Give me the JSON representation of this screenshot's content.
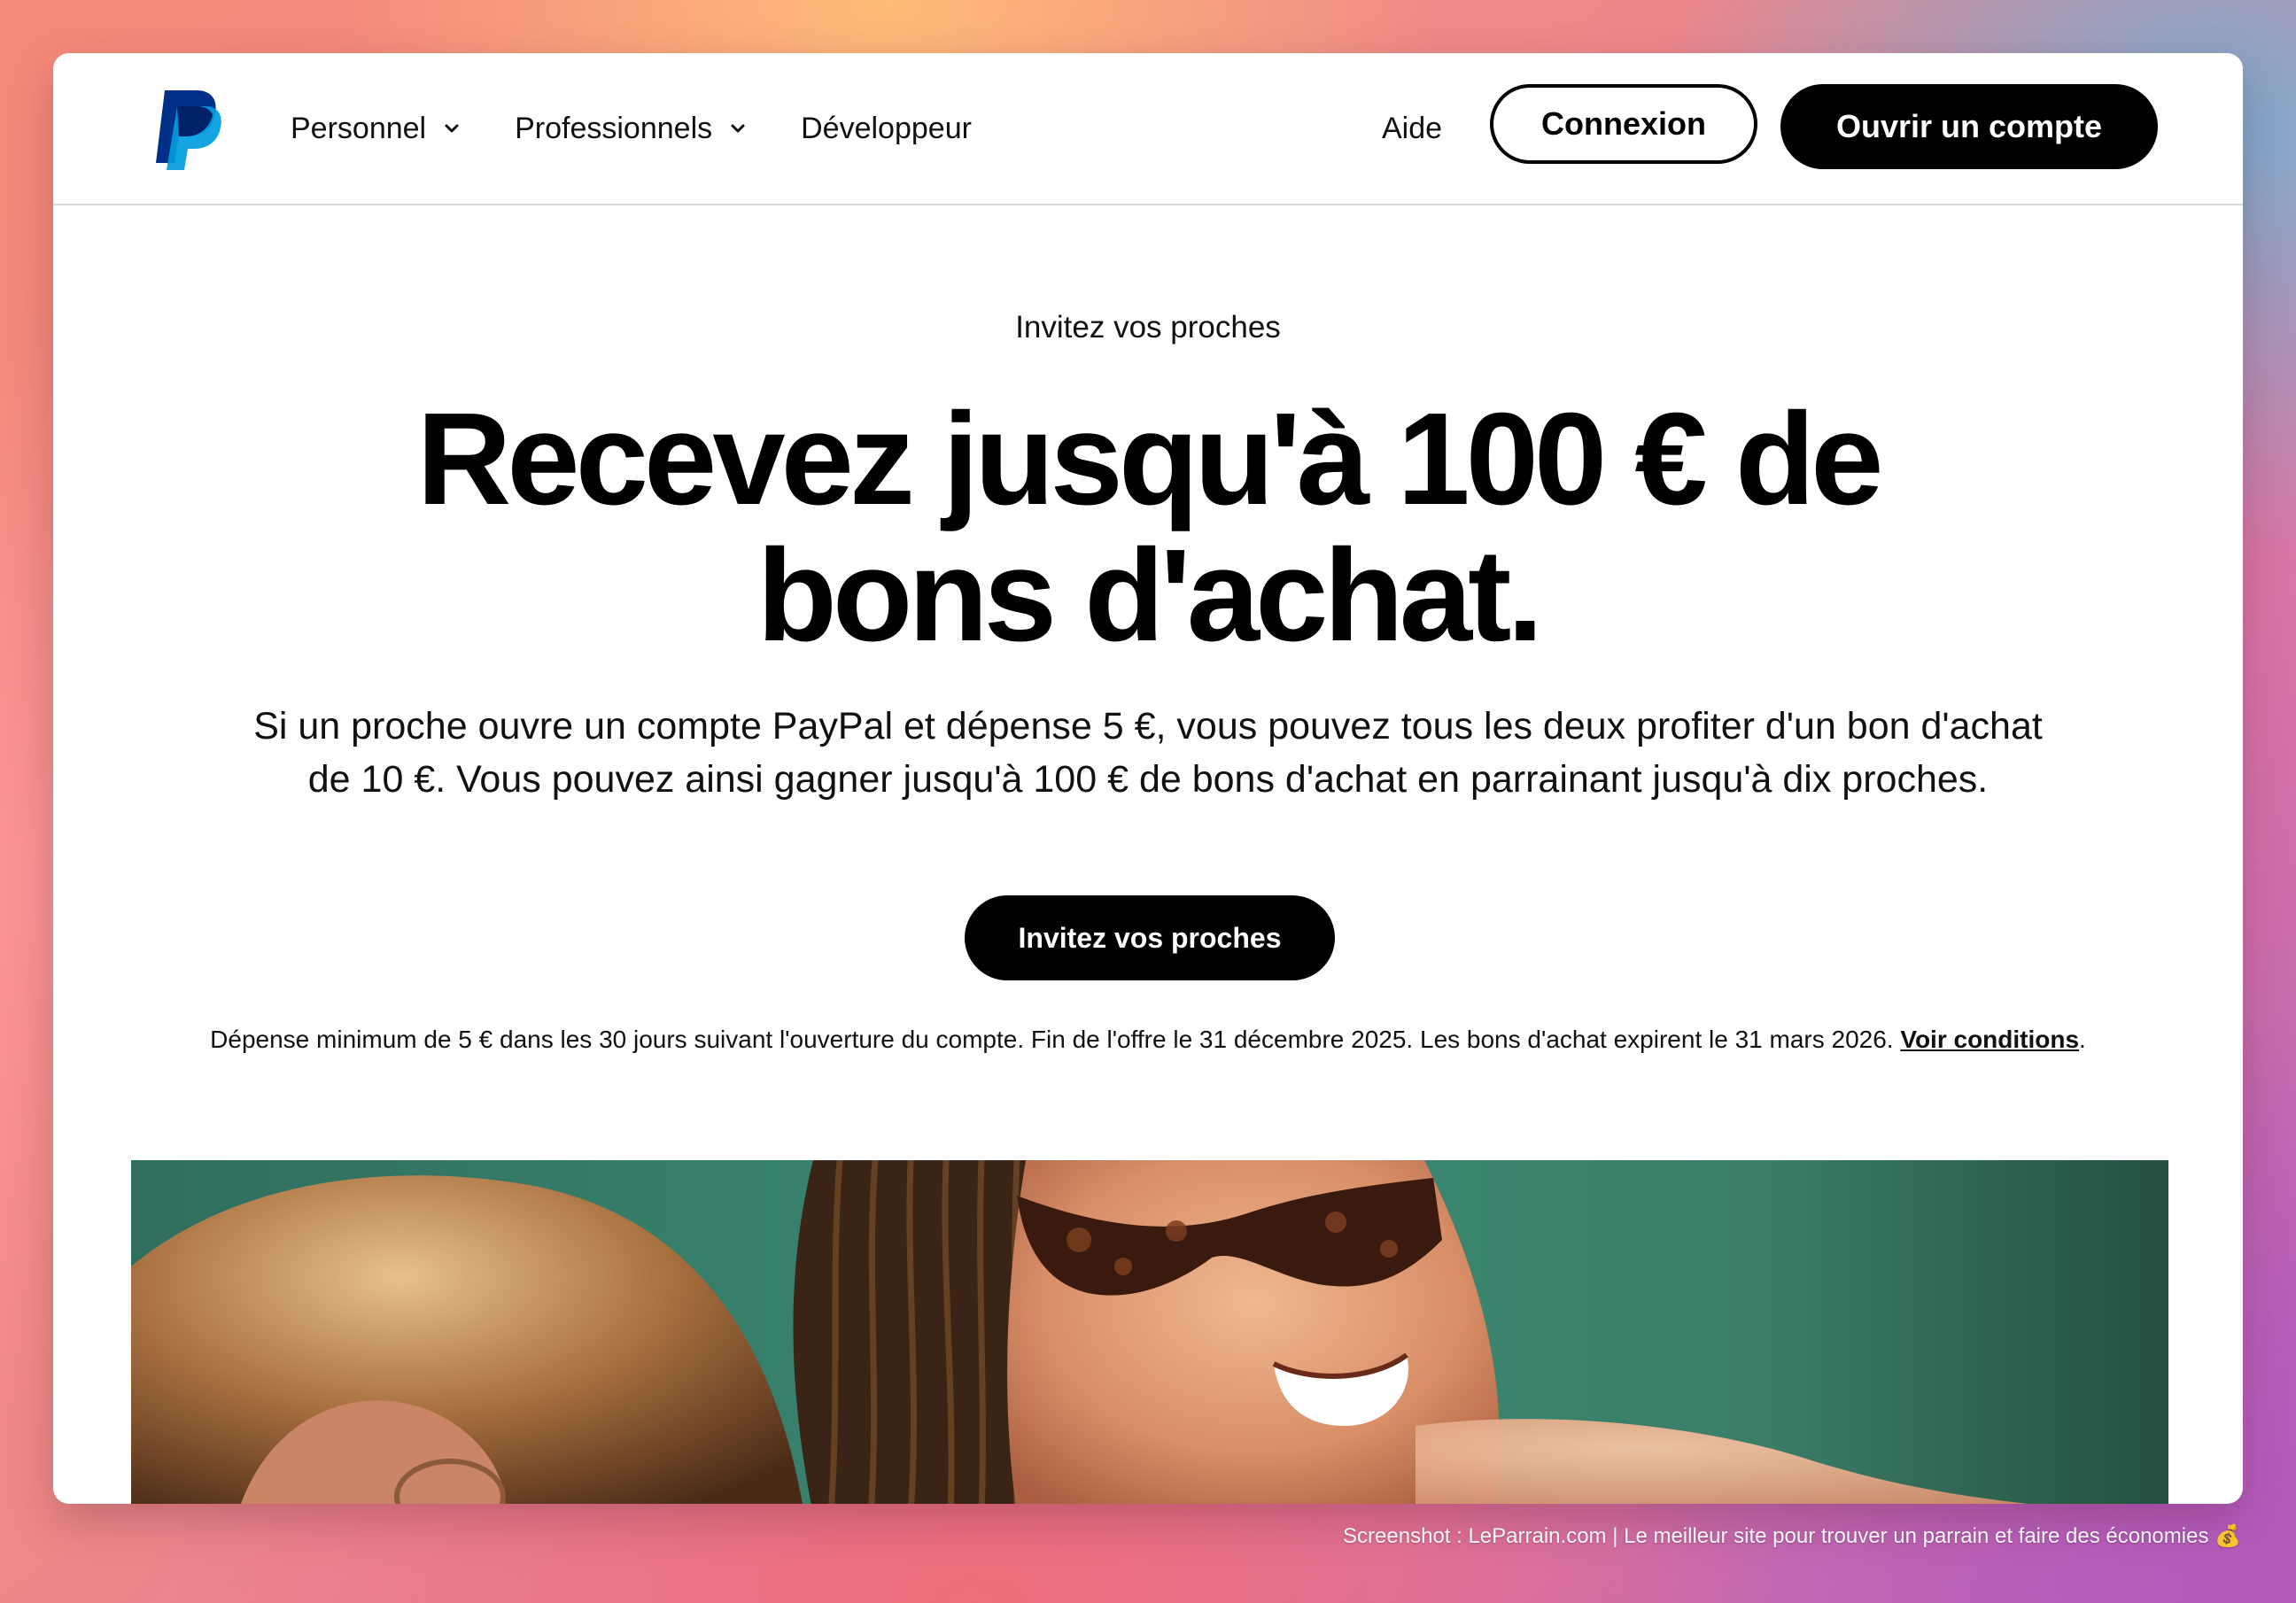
{
  "header": {
    "logo_alt": "PayPal",
    "nav": [
      {
        "label": "Personnel",
        "has_dropdown": true
      },
      {
        "label": "Professionnels",
        "has_dropdown": true
      },
      {
        "label": "Développeur",
        "has_dropdown": false
      }
    ],
    "help_label": "Aide",
    "login_label": "Connexion",
    "signup_label": "Ouvrir un compte"
  },
  "hero": {
    "eyebrow": "Invitez vos proches",
    "headline_line1": "Recevez jusqu'à 100 € de",
    "headline_line2": "bons d'achat.",
    "body": "Si un proche ouvre un compte PayPal et dépense 5 €, vous pouvez tous les deux profiter d'un bon d'achat de 10 €. Vous pouvez ainsi gagner jusqu'à 100 € de bons d'achat en parrainant jusqu'à dix proches.",
    "cta_label": "Invitez vos proches",
    "disclaimer": "Dépense minimum de 5 € dans les 30 jours suivant l'ouverture du compte. Fin de l'offre le 31 décembre 2025. Les bons d'achat expirent le 31 mars 2026. ",
    "disclaimer_link": "Voir conditions",
    "disclaimer_end": "."
  },
  "watermark": "Screenshot : LeParrain.com | Le meilleur site pour trouver un parrain et faire des économies 💰",
  "colors": {
    "brand_dark_blue": "#003087",
    "brand_light_blue": "#009cde",
    "button_black": "#000000"
  }
}
